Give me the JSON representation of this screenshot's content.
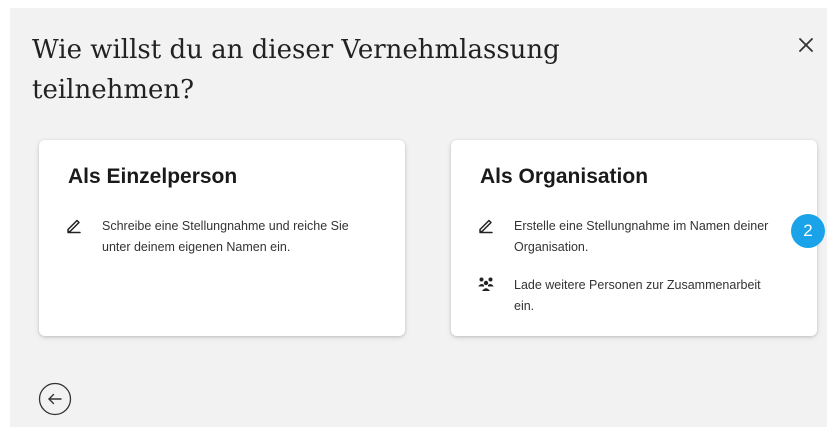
{
  "dialog": {
    "title": "Wie willst du an dieser Vernehmlassung teilnehmen?",
    "close_icon": "close-icon",
    "back_icon": "arrow-left-icon"
  },
  "options": [
    {
      "title": "Als Einzelperson",
      "features": [
        {
          "icon": "pencil-icon",
          "text": "Schreibe eine Stellungnahme und reiche Sie unter deinem eigenen Namen ein."
        }
      ]
    },
    {
      "title": "Als Organisation",
      "features": [
        {
          "icon": "pencil-icon",
          "text": "Erstelle eine Stellungnahme im Namen deiner Organisation."
        },
        {
          "icon": "people-icon",
          "text": "Lade weitere Personen zur Zusammenarbeit ein."
        }
      ]
    }
  ],
  "step_badge": "2",
  "colors": {
    "background": "#f2f2f2",
    "card": "#ffffff",
    "badge": "#1aa3e8",
    "text": "#222222"
  }
}
